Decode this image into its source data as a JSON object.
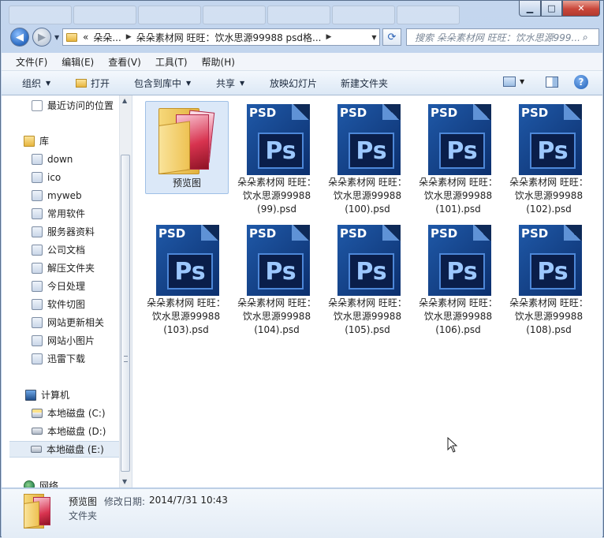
{
  "window": {
    "minimize_glyph": "▁",
    "maximize_glyph": "□",
    "close_glyph": "✕"
  },
  "nav": {
    "back_glyph": "◀",
    "forward_glyph": "▶",
    "recent_glyph": "▼",
    "refresh_glyph": "⟳"
  },
  "address": {
    "overflow": "«",
    "segments": [
      "朵朵...",
      "朵朵素材网 旺旺：饮水思源99988  psd格..."
    ],
    "separator": "▶",
    "dropdown": "▼"
  },
  "search": {
    "placeholder": "搜索 朵朵素材网 旺旺：饮水思源999...",
    "icon": "search-icon"
  },
  "menu": [
    "文件(F)",
    "编辑(E)",
    "查看(V)",
    "工具(T)",
    "帮助(H)"
  ],
  "toolbar": {
    "organize": "组织",
    "open": "打开",
    "include_library": "包含到库中",
    "share": "共享",
    "slideshow": "放映幻灯片",
    "new_folder": "新建文件夹",
    "dropdown_glyph": "▼",
    "help_glyph": "?"
  },
  "sidebar": {
    "recent": "最近访问的位置",
    "library": "库",
    "library_items": [
      "down",
      "ico",
      "myweb",
      "常用软件",
      "服务器资料",
      "公司文档",
      "解压文件夹",
      "今日处理",
      "软件切图",
      "网站更新相关",
      "网站小图片",
      "迅雷下载"
    ],
    "computer": "计算机",
    "drives": [
      "本地磁盘 (C:)",
      "本地磁盘 (D:)",
      "本地磁盘 (E:)"
    ],
    "network": "网络",
    "selected_drive": "本地磁盘 (E:)"
  },
  "scroll": {
    "up_glyph": "▲",
    "down_glyph": "▼"
  },
  "files": [
    {
      "name": "预览图",
      "type": "folder"
    },
    {
      "name": "朵朵素材网 旺旺：饮水思源99988 (99).psd",
      "type": "psd"
    },
    {
      "name": "朵朵素材网 旺旺：饮水思源99988 (100).psd",
      "type": "psd"
    },
    {
      "name": "朵朵素材网 旺旺：饮水思源99988 (101).psd",
      "type": "psd"
    },
    {
      "name": "朵朵素材网 旺旺：饮水思源99988 (102).psd",
      "type": "psd"
    },
    {
      "name": "朵朵素材网 旺旺：饮水思源99988 (103).psd",
      "type": "psd"
    },
    {
      "name": "朵朵素材网 旺旺：饮水思源99988 (104).psd",
      "type": "psd"
    },
    {
      "name": "朵朵素材网 旺旺：饮水思源99988 (105).psd",
      "type": "psd"
    },
    {
      "name": "朵朵素材网 旺旺：饮水思源99988 (106).psd",
      "type": "psd"
    },
    {
      "name": "朵朵素材网 旺旺：饮水思源99988 (108).psd",
      "type": "psd"
    }
  ],
  "psd_icon": {
    "tag": "PSD",
    "mark": "Ps"
  },
  "details": {
    "name": "预览图",
    "modified_label": "修改日期:",
    "modified_value": "2014/7/31 10:43",
    "type": "文件夹"
  }
}
